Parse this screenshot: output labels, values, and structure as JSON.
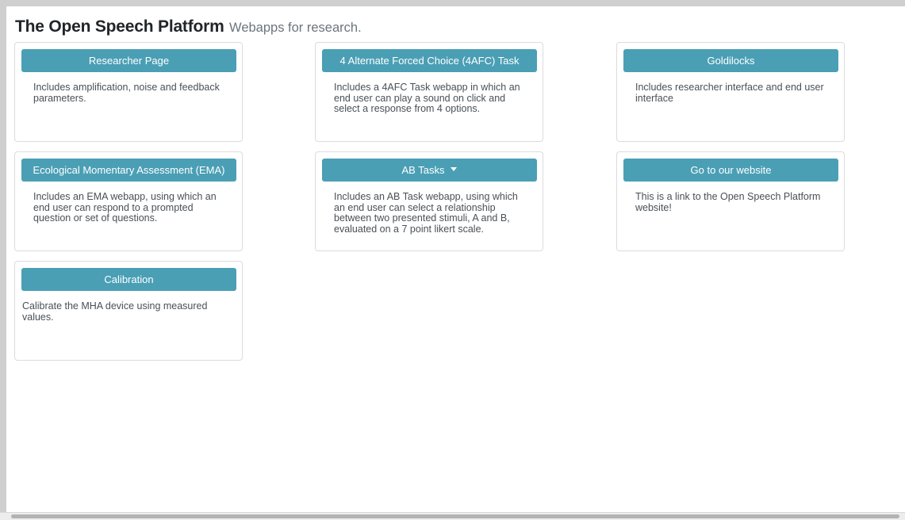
{
  "header": {
    "title": "The Open Speech Platform",
    "subtitle": "Webapps for research."
  },
  "cards": [
    {
      "button": "Researcher Page",
      "text": "Includes amplification, noise and feedback parameters."
    },
    {
      "button": "4 Alternate Forced Choice (4AFC) Task",
      "text": "Includes a 4AFC Task webapp in which an end user can play a sound on click and select a response from 4 options."
    },
    {
      "button": "Goldilocks",
      "text": "Includes researcher interface and end user interface"
    },
    {
      "button": "Ecological Momentary Assessment (EMA)",
      "text": "Includes an EMA webapp, using which an end user can respond to a prompted question or set of questions."
    },
    {
      "button": "AB Tasks",
      "text": "Includes an AB Task webapp, using which an end user can select a relationship between two presented stimuli, A and B, evaluated on a 7 point likert scale."
    },
    {
      "button": "Go to our website",
      "text": "This is a link to the Open Speech Platform website!"
    },
    {
      "button": "Calibration",
      "text": "Calibrate the MHA device using measured values."
    }
  ],
  "icons": {
    "dropdown": "caret-down-icon"
  },
  "colors": {
    "button": "#4a9fb5",
    "title": "#212529",
    "subtitle": "#6c757d",
    "card_text": "#495057"
  }
}
